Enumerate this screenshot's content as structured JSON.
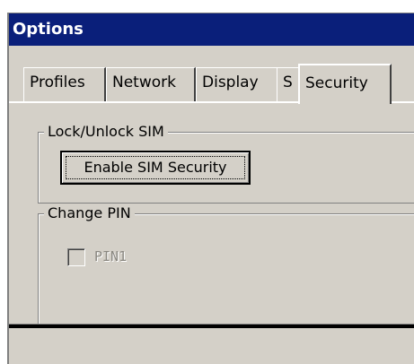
{
  "window": {
    "title": "Options"
  },
  "tabs": [
    {
      "label": "Profiles",
      "selected": false
    },
    {
      "label": "Network",
      "selected": false
    },
    {
      "label": "Display",
      "selected": false
    },
    {
      "label": "Security",
      "selected": true
    },
    {
      "label": "S",
      "selected": false
    }
  ],
  "lock_group": {
    "title": "Lock/Unlock SIM",
    "button_label": "Enable SIM Security"
  },
  "pin_group": {
    "title": "Change PIN",
    "checkbox_label": "PIN1",
    "checkbox_checked": false,
    "checkbox_enabled": false
  },
  "colors": {
    "titlebar": "#0a1f7a",
    "face": "#d4d0c8"
  }
}
